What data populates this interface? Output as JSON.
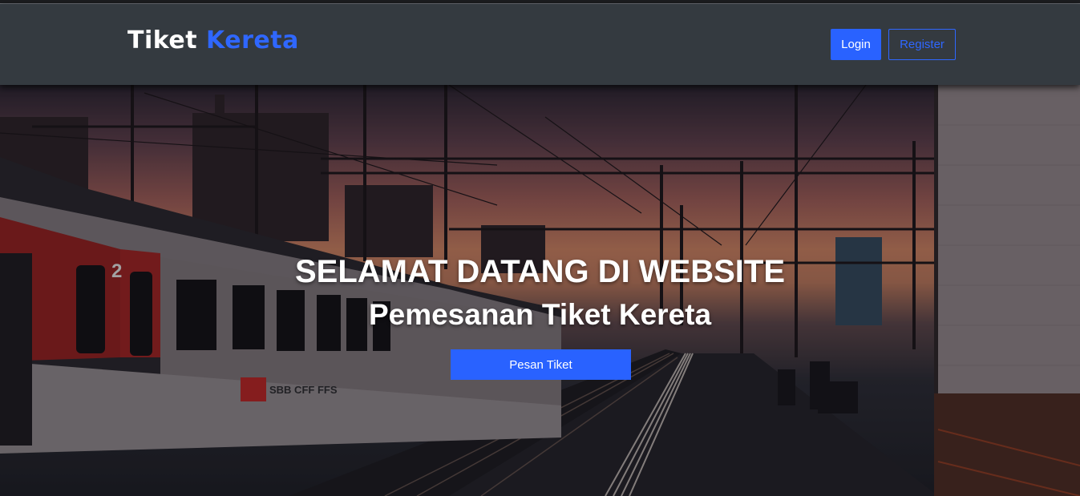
{
  "navbar": {
    "brand_part1": "Tiket",
    "brand_part2": "Kereta",
    "login_label": "Login",
    "register_label": "Register"
  },
  "hero": {
    "title": "SELAMAT DATANG DI WEBSITE",
    "subtitle": "Pemesanan Tiket Kereta",
    "cta_label": "Pesan Tiket",
    "train_number": "2",
    "train_logo": "SBB CFF FFS"
  },
  "colors": {
    "navbar_bg": "#343a40",
    "accent": "#2962ff",
    "hero_text": "#ffffff"
  }
}
